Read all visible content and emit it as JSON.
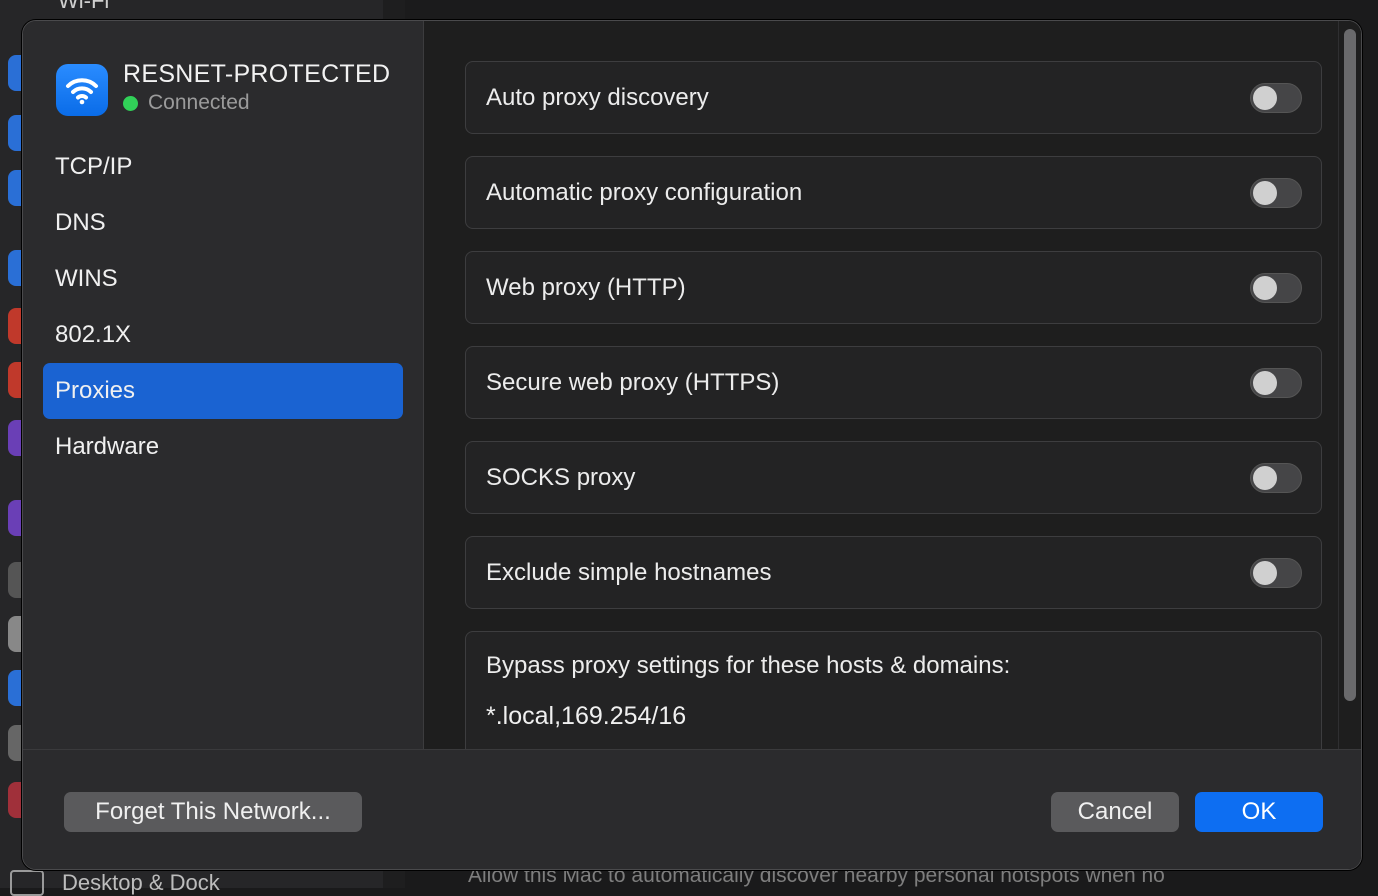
{
  "background": {
    "sidebar_top_title": "Wi-Fi",
    "bottom_left_label": "Desktop & Dock",
    "bottom_right_text": "Allow this Mac to automatically discover nearby personal hotspots when no",
    "icon_colors": [
      "#2a6fd6",
      "#2a6fd6",
      "#2a6fd6",
      "#2a6fd6",
      "#c0392b",
      "#c0392b",
      "#6a3fb6",
      "#6a3fb6",
      "#555555",
      "#888888",
      "#2a6fd6",
      "#666666",
      "#a0303a",
      "#2a6fd6"
    ]
  },
  "network": {
    "name": "RESNET-PROTECTED",
    "status": "Connected",
    "icon": "wifi-icon",
    "status_color": "#31d158"
  },
  "sidebar": {
    "items": [
      {
        "label": "TCP/IP",
        "active": false
      },
      {
        "label": "DNS",
        "active": false
      },
      {
        "label": "WINS",
        "active": false
      },
      {
        "label": "802.1X",
        "active": false
      },
      {
        "label": "Proxies",
        "active": true
      },
      {
        "label": "Hardware",
        "active": false
      }
    ]
  },
  "proxies": {
    "rows": [
      {
        "label": "Auto proxy discovery",
        "enabled": false
      },
      {
        "label": "Automatic proxy configuration",
        "enabled": false
      },
      {
        "label": "Web proxy (HTTP)",
        "enabled": false
      },
      {
        "label": "Secure web proxy (HTTPS)",
        "enabled": false
      },
      {
        "label": "SOCKS proxy",
        "enabled": false
      },
      {
        "label": "Exclude simple hostnames",
        "enabled": false
      }
    ],
    "bypass_label": "Bypass proxy settings for these hosts & domains:",
    "bypass_value": "*.local,169.254/16"
  },
  "footer": {
    "forget_label": "Forget This Network...",
    "cancel_label": "Cancel",
    "ok_label": "OK"
  },
  "colors": {
    "accent": "#0d6ef2",
    "selected_nav": "#1a63d2"
  }
}
